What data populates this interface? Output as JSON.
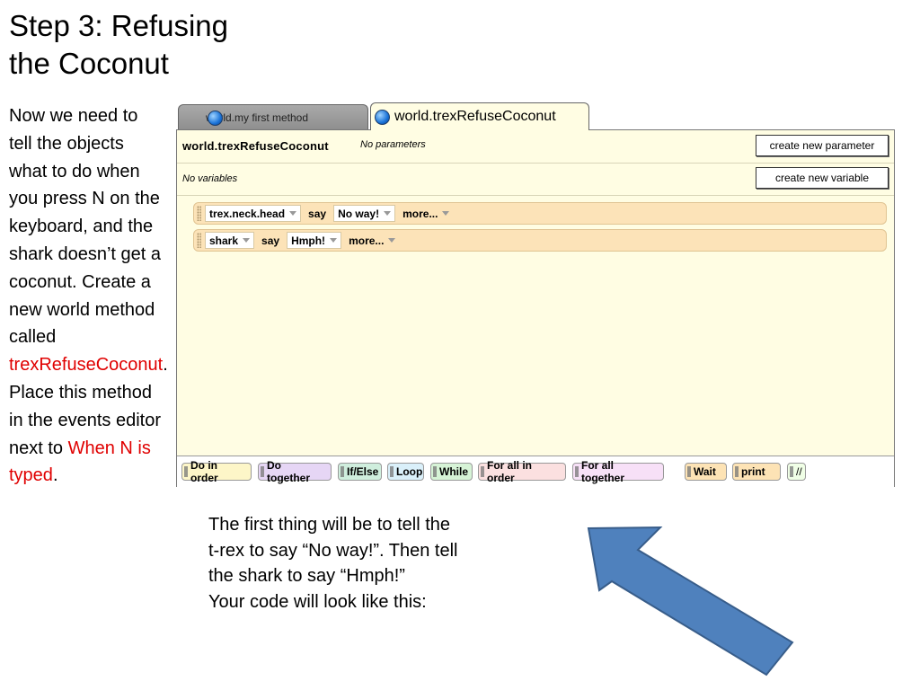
{
  "slide": {
    "title_line1": "Step 3: Refusing",
    "title_line2": "the Coconut",
    "instructions": {
      "part1": "Now we need to tell the objects what to do when you press N on the keyboard, and the shark doesn’t get a coconut. Create a new world method called ",
      "method_name": "trexRefuseCoconut",
      "part2": ". Place this method in the events editor next to ",
      "event_name": "When N is typed",
      "part3": "."
    },
    "bottom_text": {
      "line1": "The first thing will be to tell the",
      "line2": "t-rex to say “No way!”. Then tell",
      "line3": "the shark to say “Hmph!”",
      "line4": "Your code will look like this:"
    }
  },
  "editor": {
    "tabs": [
      {
        "label": "world.my first method",
        "active": false,
        "icon": "globe-icon"
      },
      {
        "label": "world.trexRefuseCoconut",
        "active": true,
        "icon": "globe-icon"
      }
    ],
    "method_name": "world.trexRefuseCoconut",
    "parameters_text": "No parameters",
    "variables_text": "No variables",
    "create_parameter_label": "create new parameter",
    "create_variable_label": "create new variable",
    "statements": [
      {
        "object": "trex.neck.head",
        "verb": "say",
        "value": "No way!",
        "more": "more..."
      },
      {
        "object": "shark",
        "verb": "say",
        "value": "Hmph!",
        "more": "more..."
      }
    ],
    "toolbar": [
      "Do in order",
      "Do together",
      "If/Else",
      "Loop",
      "While",
      "For all in order",
      "For all together",
      "Wait",
      "print",
      "//"
    ]
  },
  "colors": {
    "editor_background": "#fffde3",
    "statement_background": "#fce3b8",
    "highlight_red": "#e00000",
    "arrow_fill": "#4f81bd"
  }
}
